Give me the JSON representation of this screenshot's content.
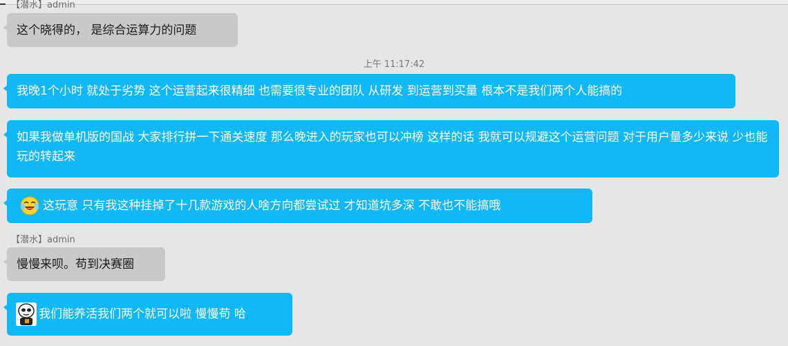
{
  "messages": [
    {
      "sender": "【潜水】admin",
      "text": "这个晓得的， 是综合运算力的问题"
    },
    {
      "timestamp": "上午 11:17:42"
    },
    {
      "text": "我晚1个小时 就处于劣势 这个运营起来很精细 也需要很专业的团队 从研发 到运营到买量 根本不是我们两个人能搞的"
    },
    {
      "text": "如果我做单机版的国战 大家排行拼一下通关速度 那么晚进入的玩家也可以冲榜 这样的话 我就可以规避这个运营问题 对于用户量多少来说 少也能玩的转起来"
    },
    {
      "icon": "crying-laughing-emoji-icon",
      "text": "这玩意 只有我这种挂掉了十几款游戏的人啥方向都尝试过 才知道坑多深 不敢也不能搞哦"
    },
    {
      "sender": "【潜水】admin",
      "text": "慢慢来呗。苟到决赛圈"
    },
    {
      "icon": "cartoon-face-sticker-icon",
      "text": "我们能养活我们两个就可以啦 慢慢苟 哈"
    }
  ],
  "colors": {
    "background": "#e6e6e6",
    "incoming_bubble": "#c9c9c9",
    "outgoing_bubble": "#12b7f5"
  }
}
